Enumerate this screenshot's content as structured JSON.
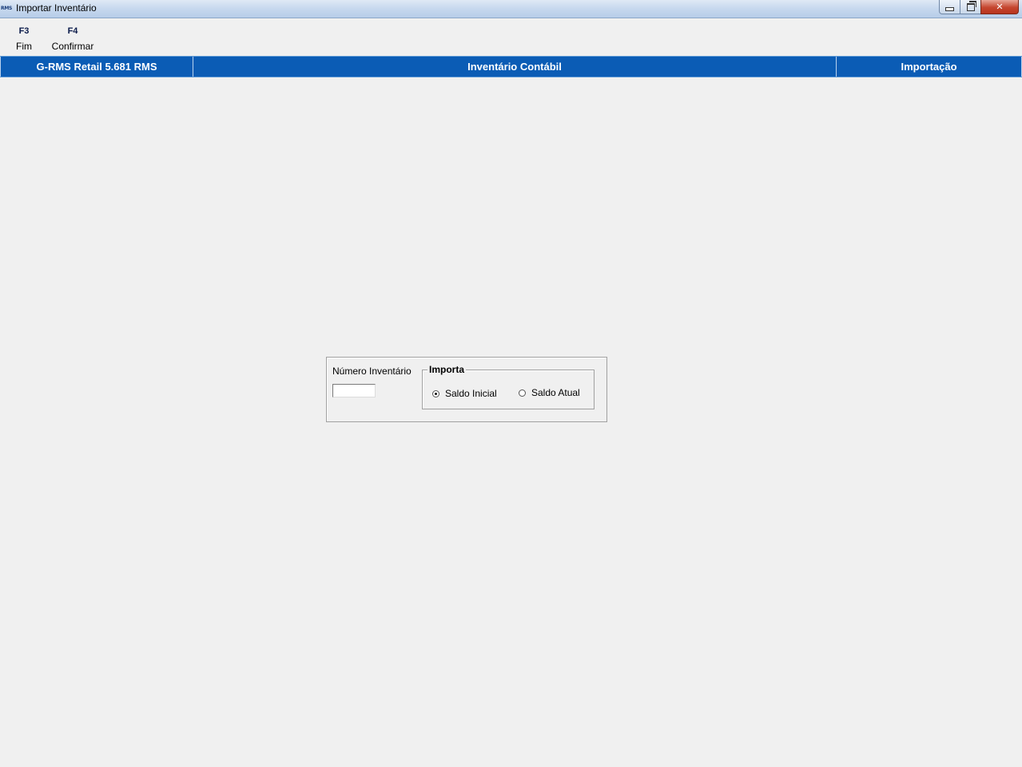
{
  "window": {
    "title": "Importar Inventário",
    "icon_text": "RMS"
  },
  "toolbar": {
    "f3": {
      "key": "F3",
      "label": "Fim"
    },
    "f4": {
      "key": "F4",
      "label": "Confirmar"
    }
  },
  "header": {
    "system": "G-RMS Retail 5.681 RMS",
    "module": "Inventário Contábil",
    "action": "Importação"
  },
  "form": {
    "numero_label": "Número Inventário",
    "numero_value": "",
    "importa_group": {
      "legend": "Importa",
      "options": [
        {
          "label": "Saldo Inicial",
          "selected": true
        },
        {
          "label": "Saldo Atual",
          "selected": false
        }
      ]
    }
  },
  "colors": {
    "header_bg": "#0b5cb5",
    "window_bg": "#f0f0f0",
    "close_button": "#c5462f"
  }
}
